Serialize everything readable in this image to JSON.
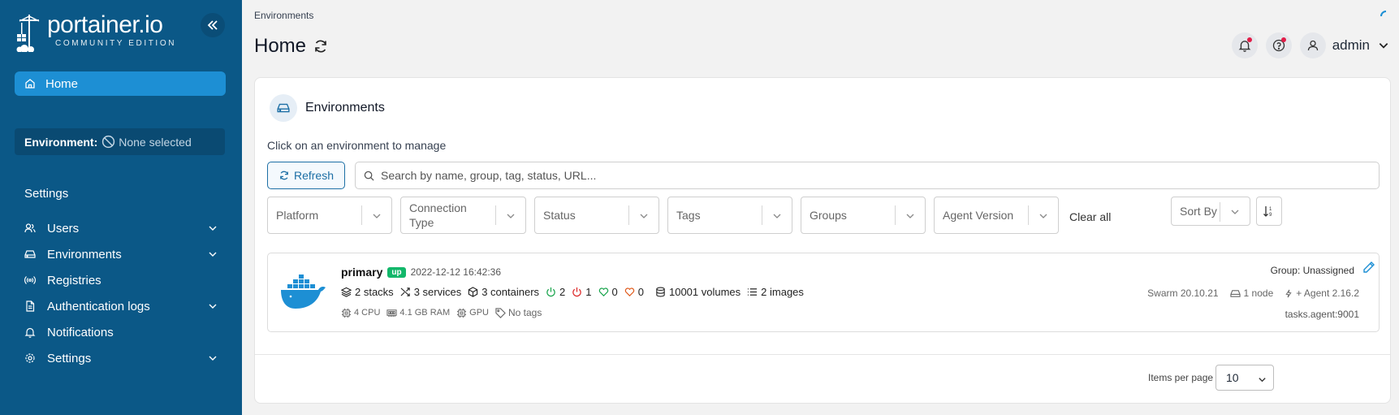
{
  "sidebar": {
    "logo_name": "portainer.io",
    "logo_edition": "COMMUNITY EDITION",
    "home_label": "Home",
    "environment_label": "Environment:",
    "environment_value": "None selected",
    "settings_heading": "Settings",
    "items": [
      {
        "label": "Users",
        "icon": "users-icon",
        "expandable": true
      },
      {
        "label": "Environments",
        "icon": "server-icon",
        "expandable": true
      },
      {
        "label": "Registries",
        "icon": "radio-icon",
        "expandable": false
      },
      {
        "label": "Authentication logs",
        "icon": "file-icon",
        "expandable": true
      },
      {
        "label": "Notifications",
        "icon": "bell-icon",
        "expandable": false
      },
      {
        "label": "Settings",
        "icon": "gear-icon",
        "expandable": true
      }
    ]
  },
  "header": {
    "breadcrumb": "Environments",
    "title": "Home",
    "user": "admin"
  },
  "card": {
    "title": "Environments",
    "subtitle": "Click on an environment to manage",
    "refresh_label": "Refresh",
    "search_placeholder": "Search by name, group, tag, status, URL...",
    "filters": [
      "Platform",
      "Connection Type",
      "Status",
      "Tags",
      "Groups",
      "Agent Version"
    ],
    "clear_all": "Clear all",
    "sort_by": "Sort By"
  },
  "environment": {
    "name": "primary",
    "status": "up",
    "date": "2022-12-12 16:42:36",
    "stacks": "2 stacks",
    "services": "3 services",
    "containers": "3 containers",
    "running": "2",
    "stopped": "1",
    "healthy": "0",
    "unhealthy": "0",
    "volumes": "10001 volumes",
    "images": "2 images",
    "cpu": "4 CPU",
    "ram": "4.1 GB RAM",
    "gpu": "GPU",
    "tags": "No tags",
    "group": "Group: Unassigned",
    "swarm": "Swarm 20.10.21",
    "nodes": "1 node",
    "agent": "+ Agent 2.16.2",
    "url": "tasks.agent:9001"
  },
  "pagination": {
    "items_per_page_label": "Items per page",
    "items_per_page": "10"
  },
  "colors": {
    "sidebar_bg": "#0b5887",
    "accent": "#1d8fd4",
    "up": "#12b76a",
    "docker_blue": "#1d8fd4"
  }
}
